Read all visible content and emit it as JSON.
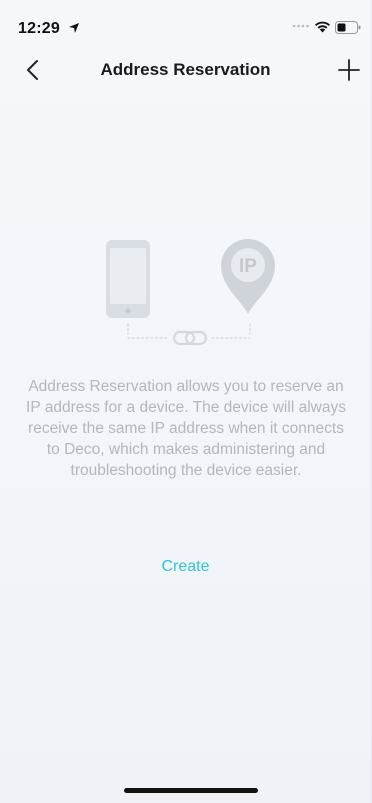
{
  "status_bar": {
    "time": "12:29"
  },
  "nav": {
    "title": "Address Reservation",
    "back_icon": "chevron-left-icon",
    "add_icon": "plus-icon"
  },
  "illustration": {
    "pin_text": "IP"
  },
  "description": "Address Reservation allows you to reserve an IP address for a device. The device will always receive the same IP address when it connects to Deco, which makes administering and troubleshooting the device easier.",
  "create_label": "Create",
  "colors": {
    "accent": "#2ec5dc",
    "muted_text": "#b3b7bd",
    "background": "#f2f5f9"
  }
}
